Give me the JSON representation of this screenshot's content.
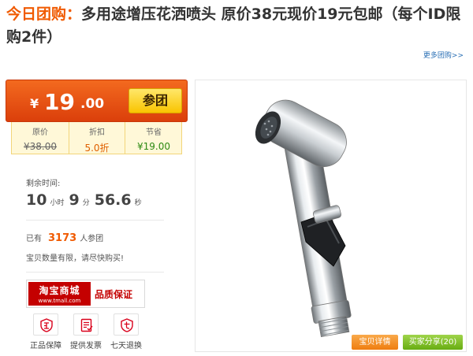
{
  "header": {
    "prefix": "今日团购：",
    "title": "多用途增压花洒喷头 原价38元现价19元包邮（每个ID限购2件）",
    "more_link": "更多团购>>"
  },
  "deal": {
    "yen": "¥",
    "price_int": "19",
    "price_dec": ".00",
    "join_label": "参团",
    "stats": [
      {
        "label": "原价",
        "value": "¥38.00"
      },
      {
        "label": "折扣",
        "value": "5.0折"
      },
      {
        "label": "节省",
        "value": "¥19.00"
      }
    ]
  },
  "countdown": {
    "label": "剩余时间:",
    "hours": "10",
    "hours_unit": "小时",
    "minutes": "9",
    "minutes_unit": "分",
    "seconds": "56.6",
    "seconds_unit": "秒"
  },
  "purchase": {
    "prefix": "已有",
    "count": "3173",
    "suffix": "人参团",
    "notice": "宝贝数量有限，请尽快购买!"
  },
  "tmall": {
    "logo_zh": "淘宝商城",
    "logo_en": "www.tmall.com",
    "quality": "品质保证"
  },
  "badges": [
    {
      "icon": "genuine-icon",
      "label": "正品保障"
    },
    {
      "icon": "invoice-icon",
      "label": "提供发票"
    },
    {
      "icon": "return-icon",
      "label": "七天退换"
    }
  ],
  "actions": {
    "detail": "宝贝详情",
    "share": "买家分享(20)"
  },
  "colors": {
    "accent_orange": "#f05a00",
    "price_red": "#db3f0b",
    "join_yellow": "#f9c400",
    "save_green": "#2b8a12",
    "tmall_red": "#c40000"
  }
}
